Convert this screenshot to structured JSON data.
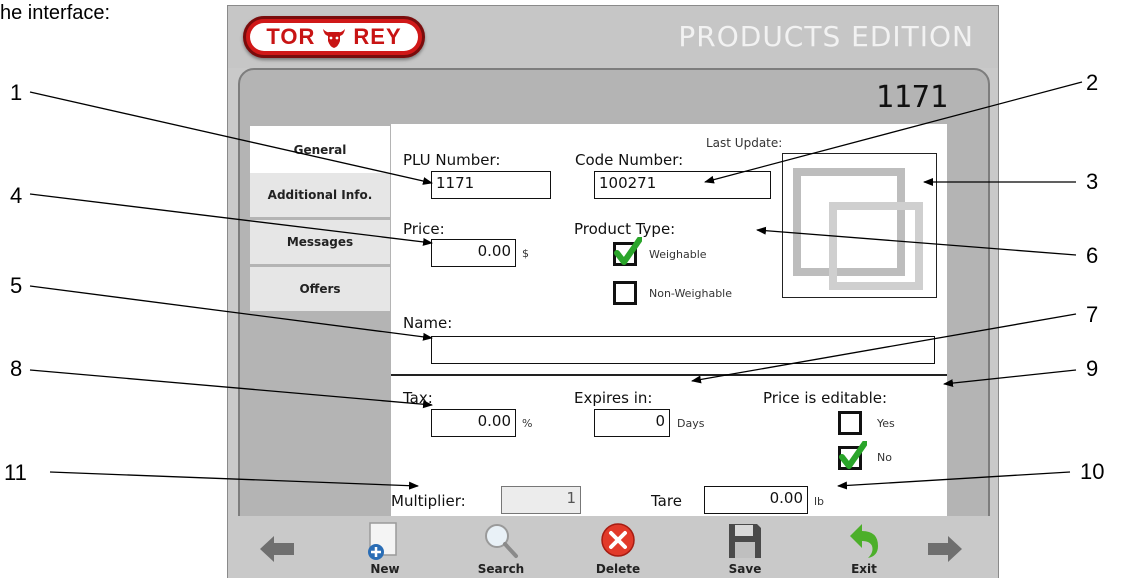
{
  "caption": "he interface:",
  "callouts": [
    "1",
    "2",
    "3",
    "4",
    "5",
    "6",
    "7",
    "8",
    "9",
    "10",
    "11"
  ],
  "app": {
    "logo_text_left": "TOR",
    "logo_text_right": "REY",
    "screen_title": "PRODUCTS EDITION",
    "plu_display": "1171"
  },
  "tabs": [
    {
      "label": "General"
    },
    {
      "label": "Additional Info."
    },
    {
      "label": "Messages"
    },
    {
      "label": "Offers"
    }
  ],
  "form": {
    "last_update_label": "Last Update:",
    "plu_label": "PLU Number:",
    "plu_value": "1171",
    "code_label": "Code Number:",
    "code_value": "100271",
    "price_label": "Price:",
    "price_value": "0.00",
    "price_unit": "$",
    "product_type_label": "Product Type:",
    "weighable_label": "Weighable",
    "non_weighable_label": "Non-Weighable",
    "name_label": "Name:",
    "name_value": "",
    "tax_label": "Tax:",
    "tax_value": "0.00",
    "tax_unit": "%",
    "expires_label": "Expires in:",
    "expires_value": "0",
    "expires_unit": "Days",
    "price_editable_label": "Price is editable:",
    "yes_label": "Yes",
    "no_label": "No",
    "multiplier_label": "Multiplier:",
    "multiplier_value": "1",
    "tare_label": "Tare",
    "tare_value": "0.00",
    "tare_unit": "lb"
  },
  "state": {
    "product_type": "Weighable",
    "price_editable": "No"
  },
  "toolbar": {
    "new": "New",
    "search": "Search",
    "delete": "Delete",
    "save": "Save",
    "exit": "Exit"
  },
  "icons": [
    "back-arrow-icon",
    "new-document-icon",
    "magnifier-icon",
    "delete-x-icon",
    "floppy-disk-icon",
    "exit-arrow-icon",
    "forward-arrow-icon",
    "checkmark-icon",
    "image-placeholder-icon",
    "bull-logo-icon"
  ],
  "colors": {
    "brand_red": "#d01818",
    "check_green": "#2aa52a",
    "delete_red": "#e23a2a",
    "frame_gray": "#c9c9c9"
  }
}
